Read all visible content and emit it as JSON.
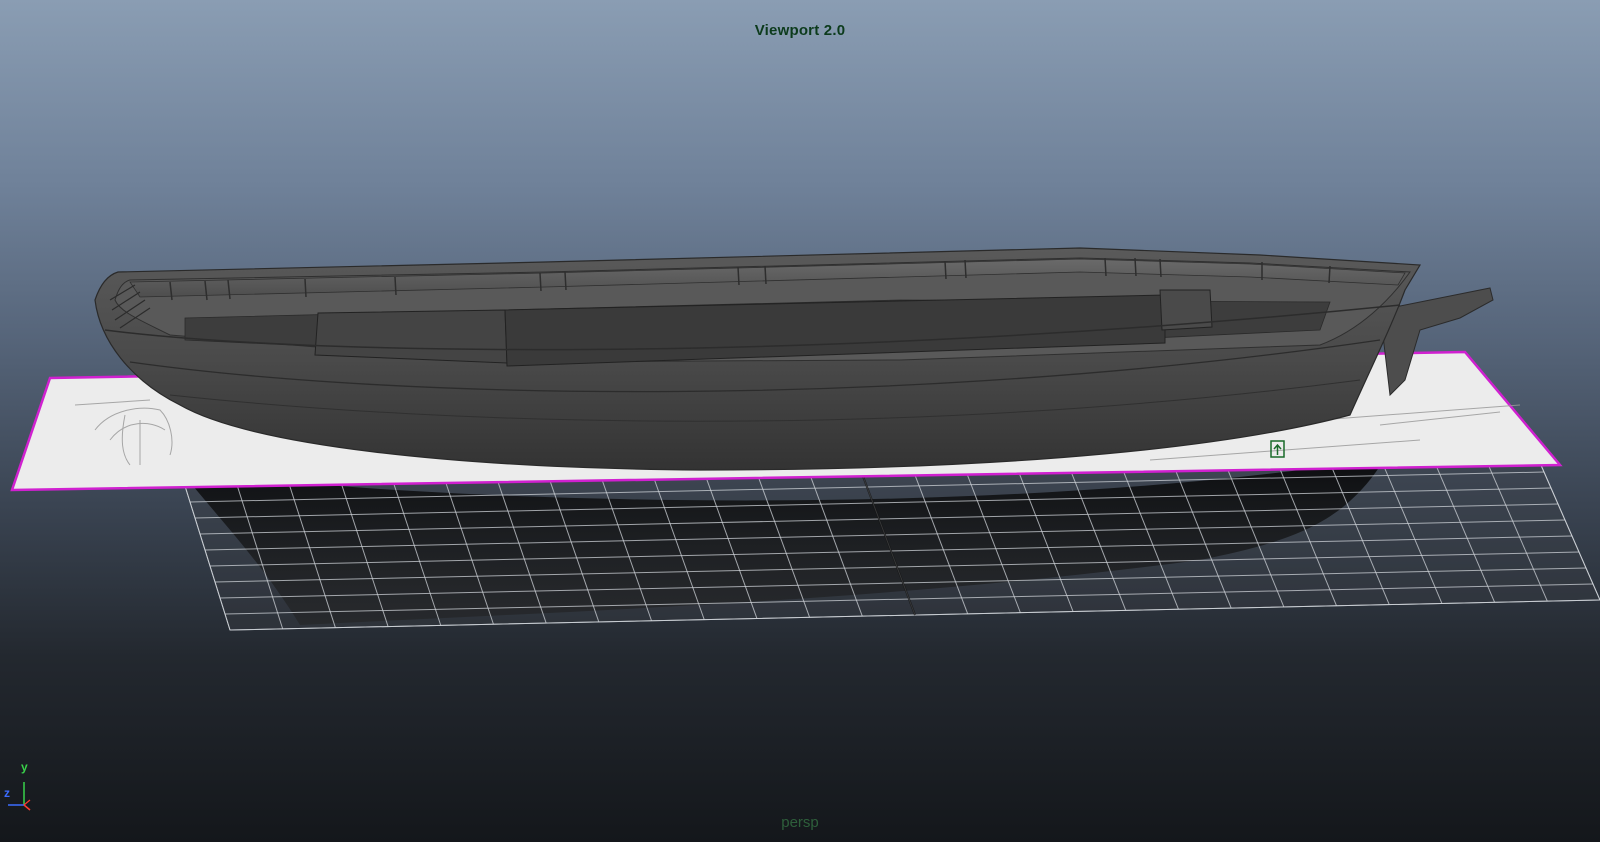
{
  "viewport": {
    "title": "Viewport 2.0",
    "camera": "persp"
  },
  "axis_gizmo": {
    "y_label": "y",
    "z_label": "z",
    "colors": {
      "x": "#ff3b30",
      "y": "#39d24a",
      "z": "#3c6cff"
    }
  },
  "scene": {
    "objects": [
      "ship-hull-model",
      "reference-image-plane",
      "ground-grid"
    ],
    "selection_color": "#d020d0",
    "hull_color": "#4a4a4a"
  }
}
